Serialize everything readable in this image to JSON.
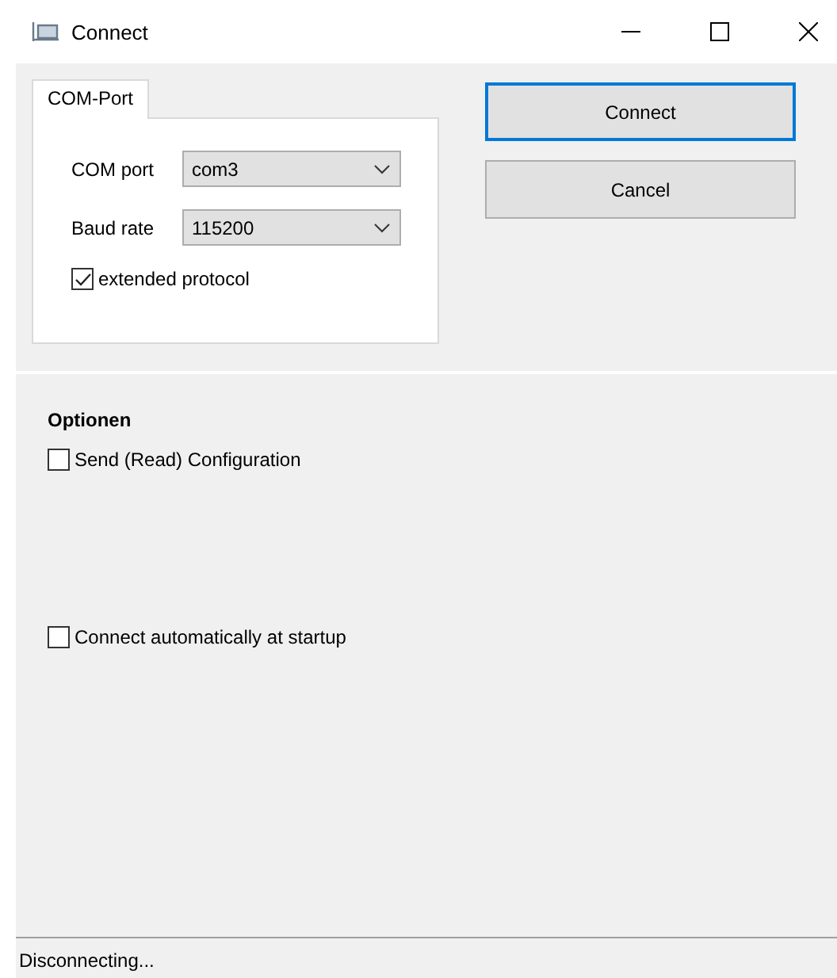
{
  "window": {
    "title": "Connect"
  },
  "tabs": [
    {
      "label": "COM-Port",
      "selected": true
    }
  ],
  "com_port": {
    "label": "COM port",
    "value": "com3"
  },
  "baud_rate": {
    "label": "Baud rate",
    "value": "115200"
  },
  "extended_protocol": {
    "label": "extended protocol",
    "checked": true
  },
  "buttons": [
    {
      "label": "Connect",
      "selected": true
    },
    {
      "label": "Cancel",
      "selected": false
    }
  ],
  "options": {
    "title": "Optionen",
    "items": [
      {
        "label": "Send (Read) Configuration",
        "checked": false
      },
      {
        "label": "Connect automatically at startup",
        "checked": false
      }
    ]
  },
  "status_bar": "Disconnecting..."
}
